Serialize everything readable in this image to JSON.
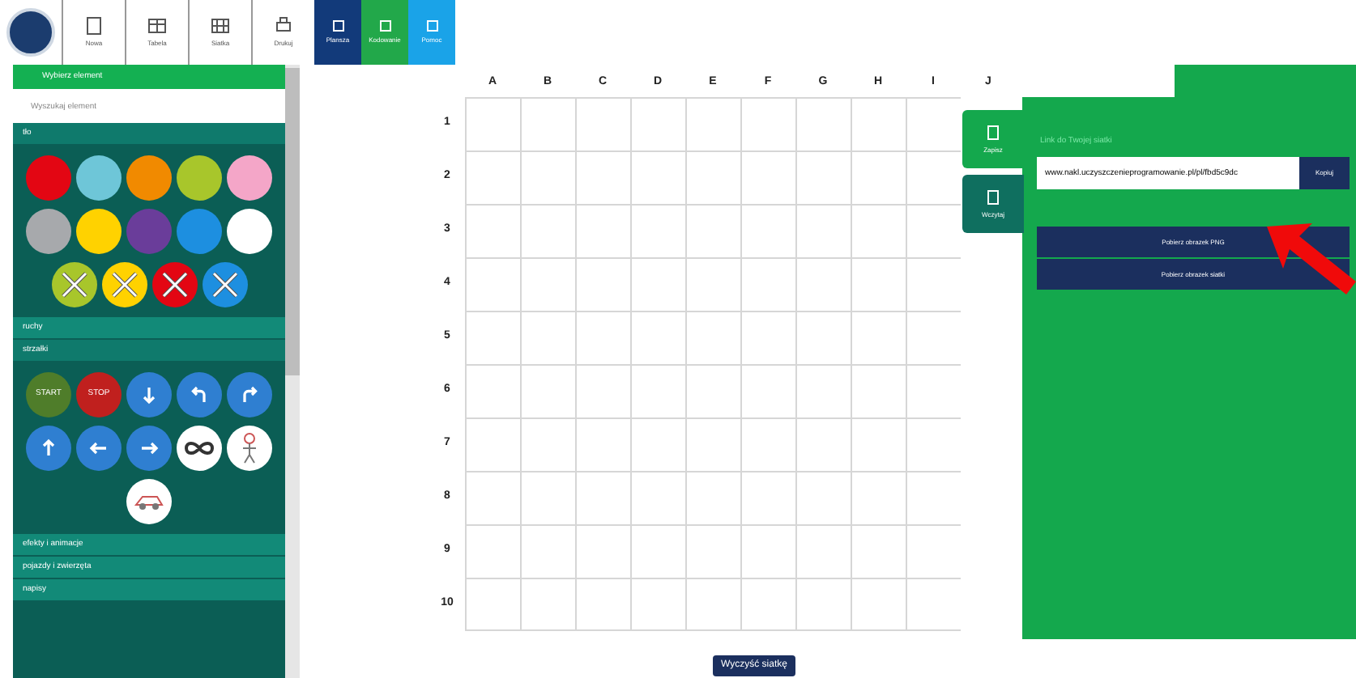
{
  "toolbar": {
    "tools": [
      {
        "label": "Nowa"
      },
      {
        "label": "Tabela"
      },
      {
        "label": "Siatka"
      },
      {
        "label": "Drukuj"
      }
    ],
    "modes": [
      {
        "label": "Plansza",
        "color": "#123a7a"
      },
      {
        "label": "Kodowanie",
        "color": "#22a84a"
      },
      {
        "label": "Pomoc",
        "color": "#1aa3e8"
      }
    ]
  },
  "sidebar": {
    "banner": "Wybierz element",
    "search": {
      "placeholder": "Wyszukaj element"
    },
    "sections": [
      {
        "title": "tło",
        "expanded": true,
        "swatches": [
          {
            "color": "#e30613",
            "crossed": false
          },
          {
            "color": "#6ec6d8",
            "crossed": false
          },
          {
            "color": "#f18a00",
            "crossed": false
          },
          {
            "color": "#a8c62b",
            "crossed": false
          },
          {
            "color": "#f4a6c8",
            "crossed": false
          },
          {
            "color": "#a7a9ac",
            "crossed": false
          },
          {
            "color": "#ffd200",
            "crossed": false
          },
          {
            "color": "#6a3d9a",
            "crossed": false
          },
          {
            "color": "#1d8fe0",
            "crossed": false
          },
          {
            "color": "#ffffff",
            "crossed": false
          },
          {
            "color": "#a8c62b",
            "crossed": true
          },
          {
            "color": "#ffd200",
            "crossed": true
          },
          {
            "color": "#e30613",
            "crossed": true
          },
          {
            "color": "#1d8fe0",
            "crossed": true
          }
        ]
      },
      {
        "title": "ruchy",
        "expanded": false
      },
      {
        "title": "strzałki",
        "expanded": true,
        "commands": [
          {
            "kind": "start",
            "text": "START"
          },
          {
            "kind": "stop",
            "text": "STOP"
          },
          {
            "kind": "down"
          },
          {
            "kind": "turn-left"
          },
          {
            "kind": "turn-right"
          },
          {
            "kind": "up"
          },
          {
            "kind": "left"
          },
          {
            "kind": "right"
          },
          {
            "kind": "loop"
          },
          {
            "kind": "figure"
          },
          {
            "kind": "vehicle"
          }
        ]
      },
      {
        "title": "efekty i animacje",
        "expanded": false
      },
      {
        "title": "pojazdy i zwierzęta",
        "expanded": false
      },
      {
        "title": "napisy",
        "expanded": false
      }
    ]
  },
  "grid": {
    "columns": [
      "A",
      "B",
      "C",
      "D",
      "E",
      "F",
      "G",
      "H",
      "I",
      "J"
    ],
    "rows": [
      "1",
      "2",
      "3",
      "4",
      "5",
      "6",
      "7",
      "8",
      "9",
      "10"
    ],
    "clear_button": "Wyczyść siatkę"
  },
  "panel": {
    "tabs": [
      {
        "label": "Zapisz",
        "selected": true
      },
      {
        "label": "Wczytaj",
        "selected": false
      }
    ],
    "link_label": "Link do Twojej siatki",
    "link_value": "www.nakl.uczyszczenieprogramowanie.pl/pl/fbd5c9dc",
    "copy_button": "Kopiuj",
    "buttons": [
      "Pobierz obrazek PNG",
      "Pobierz obrazek siatki"
    ]
  }
}
